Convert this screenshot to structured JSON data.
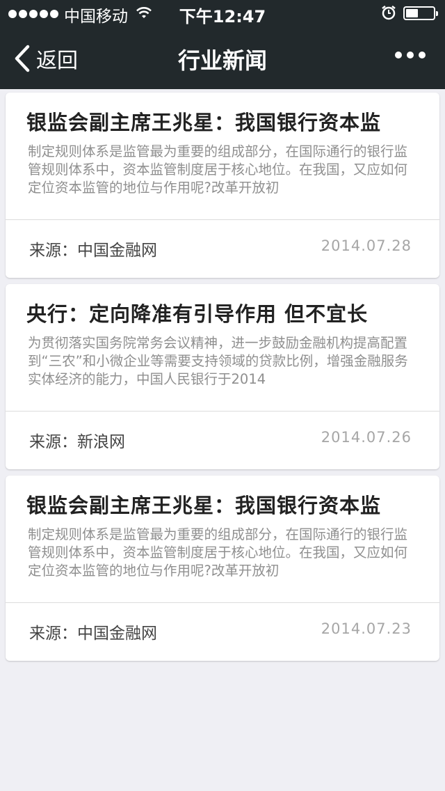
{
  "status_bar": {
    "carrier": "中国移动",
    "time": "下午12:47",
    "battery_level": 0.45,
    "signal_icon": "signal-dots-icon",
    "wifi_icon": "wifi-icon",
    "alarm_icon": "alarm-clock-icon",
    "battery_icon": "battery-icon"
  },
  "nav": {
    "back_label": "返回",
    "back_icon": "chevron-left-icon",
    "title": "行业新闻",
    "more_icon": "more-dots-icon"
  },
  "colors": {
    "topbar": "#22292c",
    "background": "#efeff4",
    "card": "#ffffff",
    "title_text": "#222222",
    "summary_text": "#8f8f8f",
    "date_text": "#a6a6a6"
  },
  "articles": [
    {
      "title": "银监会副主席王兆星：我国银行资本监",
      "summary": "制定规则体系是监管最为重要的组成部分，在国际通行的银行监管规则体系中，资本监管制度居于核心地位。在我国，又应如何定位资本监管的地位与作用呢?改革开放初",
      "source": "来源：中国金融网",
      "date": "2014.07.28"
    },
    {
      "title": "央行：定向降准有引导作用 但不宜长",
      "summary": "为贯彻落实国务院常务会议精神，进一步鼓励金融机构提高配置到“三农”和小微企业等需要支持领域的贷款比例，增强金融服务实体经济的能力，中国人民银行于2014",
      "source": "来源：新浪网",
      "date": "2014.07.26"
    },
    {
      "title": "银监会副主席王兆星：我国银行资本监",
      "summary": "制定规则体系是监管最为重要的组成部分，在国际通行的银行监管规则体系中，资本监管制度居于核心地位。在我国，又应如何定位资本监管的地位与作用呢?改革开放初",
      "source": "来源：中国金融网",
      "date": "2014.07.23"
    }
  ]
}
